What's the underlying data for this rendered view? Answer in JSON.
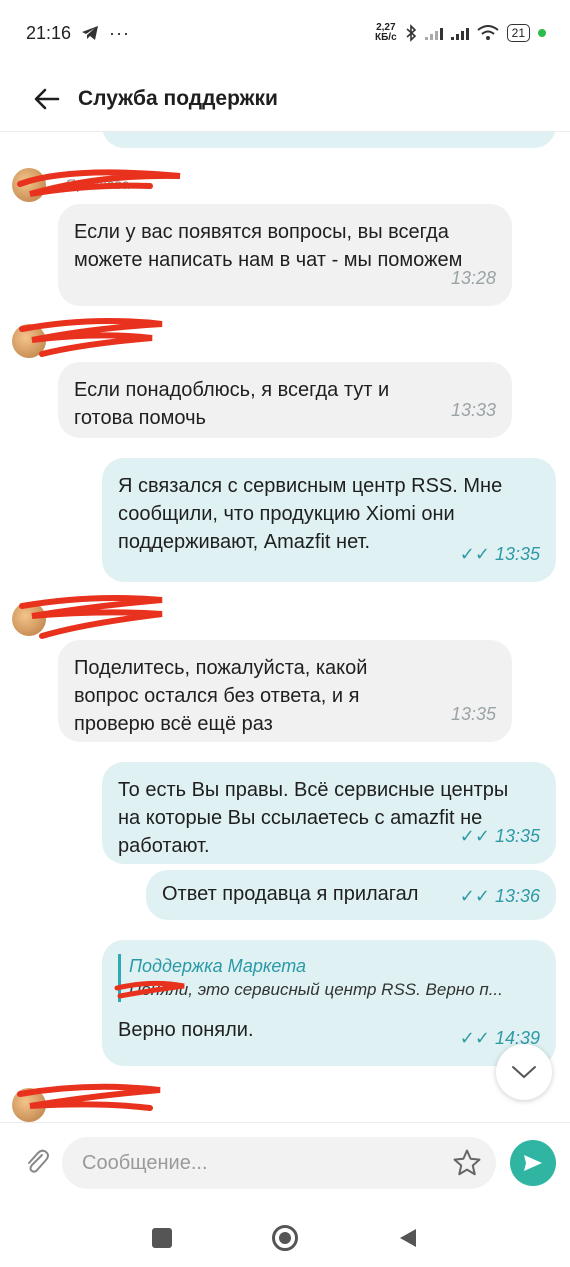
{
  "status_bar": {
    "time": "21:16",
    "icons": [
      "telegram-icon",
      "more-icon",
      "bluetooth-icon",
      "signal-icon",
      "wifi-icon",
      "battery-icon"
    ],
    "speed_value": "2,27",
    "speed_unit": "КБ/с",
    "battery": "21"
  },
  "header": {
    "title": "Служба поддержки"
  },
  "messages": [
    {
      "type": "incoming",
      "text": "Если у вас появятся вопросы, вы всегда можете написать нам в чат - мы поможем",
      "time": "13:28"
    },
    {
      "type": "incoming",
      "text": "Если понадоблюсь, я всегда тут и готова помочь",
      "time": "13:33"
    },
    {
      "type": "outgoing",
      "text": "Я связался с сервисным центр RSS. Мне сообщили, что продукцию Xiomi они поддерживают, Amazfit нет.",
      "time": "13:35"
    },
    {
      "type": "incoming",
      "text": "Поделитесь, пожалуйста, какой вопрос остался без ответа, и я проверю всё ещё раз",
      "time": "13:35"
    },
    {
      "type": "outgoing",
      "text": "То есть Вы правы. Всё сервисные центры на которые Вы ссылаетесь с amazfit не работают.",
      "time": "13:35"
    },
    {
      "type": "outgoing",
      "text": "Ответ продавца я прилагал",
      "time": "13:36"
    },
    {
      "type": "outgoing",
      "quote_name": "Поддержка Маркета",
      "quote_text": "Поняли, это сервисный центр RSS.  Верно п...",
      "text": "Верно поняли.",
      "time": "14:39"
    }
  ],
  "sender_name_partial": "Ярослава",
  "composer": {
    "placeholder": "Сообщение..."
  },
  "colors": {
    "accent": "#2fb5a2",
    "outgoing_bubble": "#dff1f3",
    "incoming_bubble": "#f1f1f1"
  }
}
